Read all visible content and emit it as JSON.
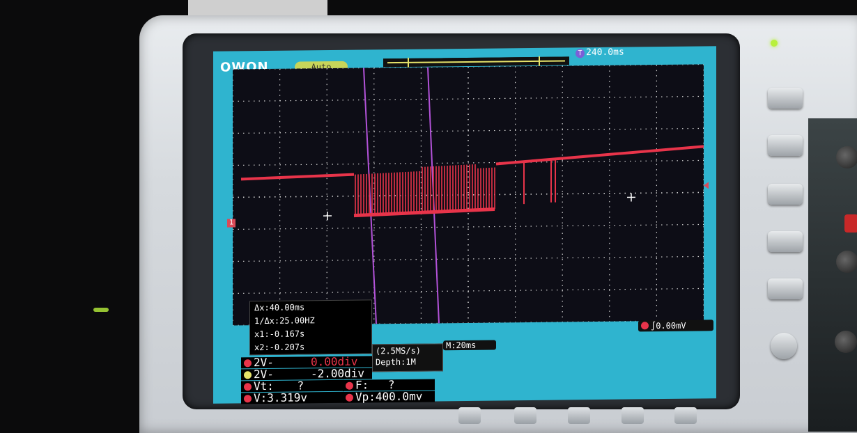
{
  "brand": "OWON",
  "trigger_mode": "Auto",
  "time_delay": "240.0ms",
  "channel_marker": "1",
  "measurements": {
    "delta_x": "Δx:40.00ms",
    "inv_delta_x": "1/Δx:25.00HZ",
    "x1": "x1:-0.167s",
    "x2": "x2:-0.207s"
  },
  "channels": {
    "ch1_scale": "2V-",
    "ch1_offset": "0.00div",
    "ch2_scale": "2V-",
    "ch2_offset": "-2.00div",
    "vt": "Vt:",
    "vt_value": "?",
    "f": "F:",
    "f_value": "?",
    "v": "V:3.319v",
    "vp": "Vp:400.0mv"
  },
  "sample_rate": "(2.5MS/s)",
  "depth": "Depth:1M",
  "main_timebase": "M:20ms",
  "trigger_level": "0.00mV",
  "colors": {
    "screen_cyan": "#2fb4cf",
    "trace_red": "#e8344a",
    "cursor_purple": "#b252d8",
    "grid_white": "#cfcfcf",
    "auto_badge": "#c7d55a"
  },
  "icons": {
    "trigger_edge": "rising-edge-icon",
    "channel_dot": "circle-icon",
    "time_marker": "T-icon"
  }
}
